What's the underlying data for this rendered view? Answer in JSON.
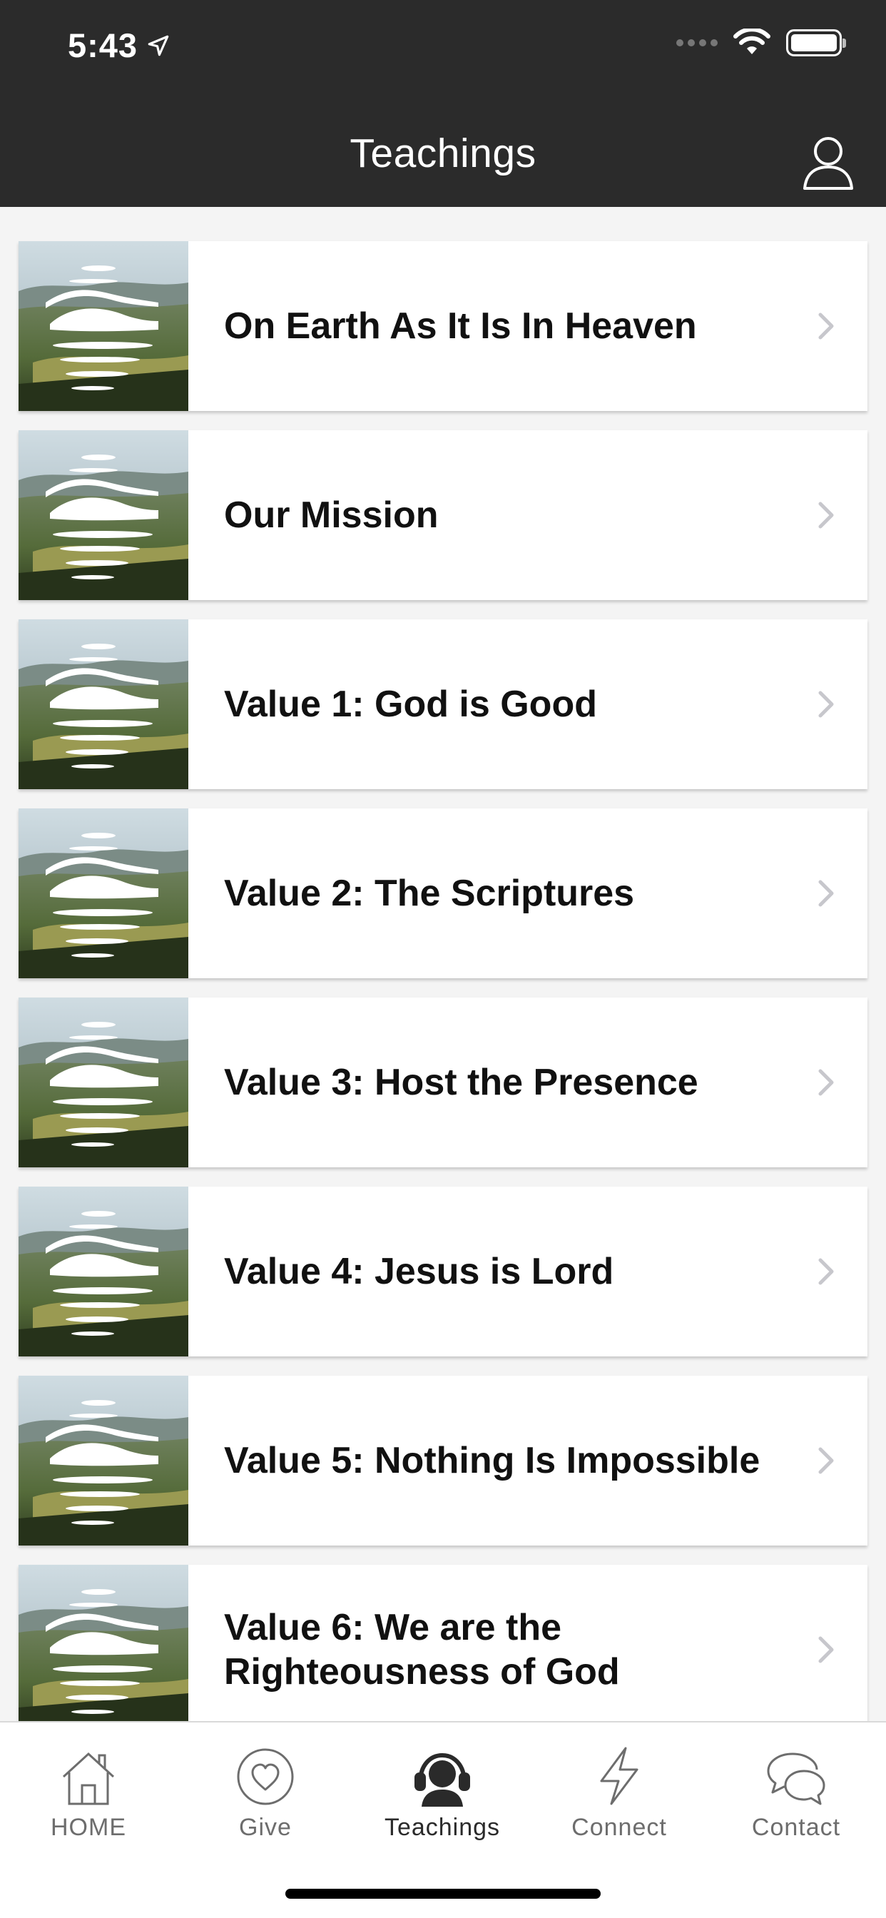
{
  "status_bar": {
    "time": "5:43"
  },
  "nav": {
    "title": "Teachings"
  },
  "teachings": [
    {
      "title": "On Earth As It Is In Heaven"
    },
    {
      "title": "Our Mission"
    },
    {
      "title": "Value 1: God is Good"
    },
    {
      "title": "Value 2: The Scriptures"
    },
    {
      "title": "Value 3: Host the Presence"
    },
    {
      "title": "Value 4: Jesus is Lord"
    },
    {
      "title": "Value 5: Nothing Is Impossible"
    },
    {
      "title": "Value 6: We are the Righteousness of God"
    }
  ],
  "tabs": [
    {
      "label": "HOME",
      "icon": "house-icon"
    },
    {
      "label": "Give",
      "icon": "heart-circle-icon"
    },
    {
      "label": "Teachings",
      "icon": "headphones-person-icon",
      "active": true
    },
    {
      "label": "Connect",
      "icon": "lightning-icon"
    },
    {
      "label": "Contact",
      "icon": "chat-bubbles-icon"
    }
  ],
  "colors": {
    "header_bg": "#2b2b2b",
    "background": "#f4f4f4",
    "card_bg": "#ffffff",
    "tab_inactive": "#6d6d6d"
  }
}
